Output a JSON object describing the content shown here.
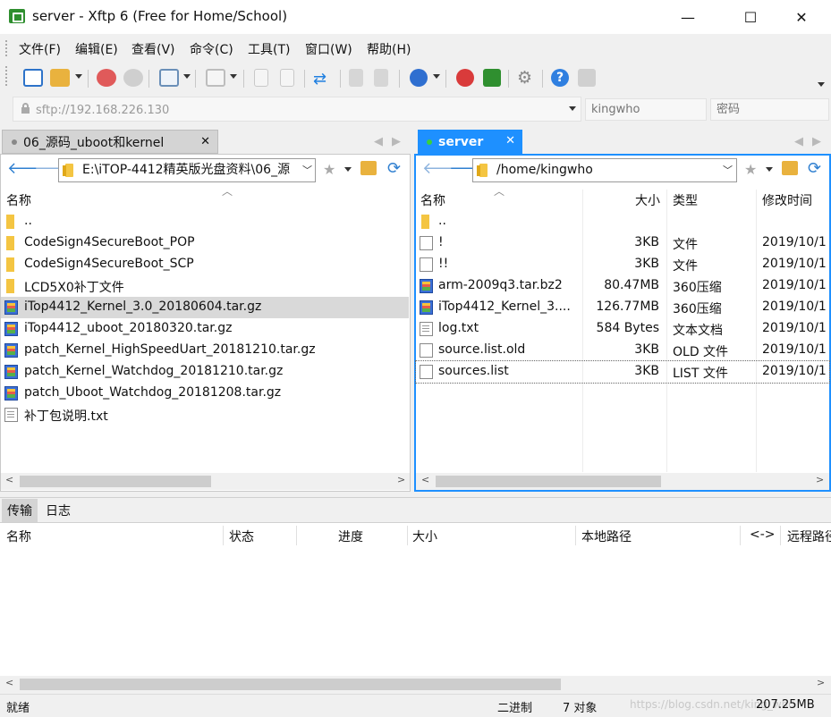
{
  "window": {
    "title": "server - Xftp 6 (Free for Home/School)",
    "minimize": "—",
    "maximize": "☐",
    "close": "✕"
  },
  "menu": [
    "文件(F)",
    "编辑(E)",
    "查看(V)",
    "命令(C)",
    "工具(T)",
    "窗口(W)",
    "帮助(H)"
  ],
  "address": {
    "value": "sftp://192.168.226.130",
    "user_placeholder": "kingwho",
    "pass_placeholder": "密码"
  },
  "left": {
    "tab": "06_源码_uboot和kernel",
    "path": "E:\\iTOP-4412精英版光盘资料\\06_源",
    "header": {
      "name": "名称"
    },
    "files": [
      {
        "name": "..",
        "type": "folder"
      },
      {
        "name": "CodeSign4SecureBoot_POP",
        "type": "folder"
      },
      {
        "name": "CodeSign4SecureBoot_SCP",
        "type": "folder"
      },
      {
        "name": "LCD5X0补丁文件",
        "type": "folder"
      },
      {
        "name": "iTop4412_Kernel_3.0_20180604.tar.gz",
        "type": "archive",
        "selected": true
      },
      {
        "name": "iTop4412_uboot_20180320.tar.gz",
        "type": "archive"
      },
      {
        "name": "patch_Kernel_HighSpeedUart_20181210.tar.gz",
        "type": "archive"
      },
      {
        "name": "patch_Kernel_Watchdog_20181210.tar.gz",
        "type": "archive"
      },
      {
        "name": "patch_Uboot_Watchdog_20181208.tar.gz",
        "type": "archive"
      },
      {
        "name": "补丁包说明.txt",
        "type": "txt"
      }
    ]
  },
  "right": {
    "tab": "server",
    "path": "/home/kingwho",
    "header": {
      "name": "名称",
      "size": "大小",
      "type": "类型",
      "modified": "修改时间"
    },
    "files": [
      {
        "name": "..",
        "size": "",
        "type": "",
        "modified": "",
        "icon": "folder"
      },
      {
        "name": "!",
        "size": "3KB",
        "type": "文件",
        "modified": "2019/10/1",
        "icon": "file"
      },
      {
        "name": "!!",
        "size": "3KB",
        "type": "文件",
        "modified": "2019/10/1",
        "icon": "file"
      },
      {
        "name": "arm-2009q3.tar.bz2",
        "size": "80.47MB",
        "type": "360压缩",
        "modified": "2019/10/1",
        "icon": "archive"
      },
      {
        "name": "iTop4412_Kernel_3....",
        "size": "126.77MB",
        "type": "360压缩",
        "modified": "2019/10/1",
        "icon": "archive"
      },
      {
        "name": "log.txt",
        "size": "584 Bytes",
        "type": "文本文档",
        "modified": "2019/10/1",
        "icon": "txt"
      },
      {
        "name": "source.list.old",
        "size": "3KB",
        "type": "OLD 文件",
        "modified": "2019/10/1",
        "icon": "file"
      },
      {
        "name": "sources.list",
        "size": "3KB",
        "type": "LIST 文件",
        "modified": "2019/10/1",
        "icon": "file"
      }
    ]
  },
  "transfer": {
    "tabs": [
      "传输",
      "日志"
    ],
    "columns": [
      "名称",
      "状态",
      "进度",
      "大小",
      "本地路径",
      "<->",
      "远程路径"
    ]
  },
  "status": {
    "ready": "就绪",
    "mode": "二进制",
    "objects": "7 对象",
    "size": "207.25MB",
    "watermark": "https://blog.csdn.net/king_who"
  },
  "colors": {
    "accent": "#1e90ff",
    "selection": "#d9d9d9"
  }
}
